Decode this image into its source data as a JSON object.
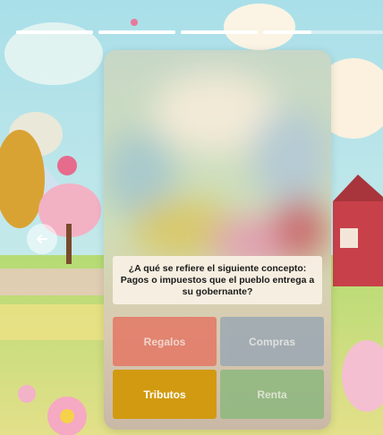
{
  "progress": {
    "total_segments": 4,
    "filled_fraction": [
      1,
      1,
      1,
      0.4
    ]
  },
  "question": {
    "text": "¿A qué se refiere el siguiente concepto: Pagos o impuestos que el pueblo entrega a su gobernante?"
  },
  "options": [
    {
      "label": "Regalos",
      "color": "#e47562",
      "selected": false
    },
    {
      "label": "Compras",
      "color": "#98a7b3",
      "selected": false
    },
    {
      "label": "Tributos",
      "color": "#d29a10",
      "selected": true
    },
    {
      "label": "Renta",
      "color": "#8ab87c",
      "selected": false
    }
  ],
  "colors": {
    "sky": "#bfe6ee",
    "meadow": "#9ed06b",
    "card_overlay": "#d8c9b6",
    "question_bg": "#f8f0e4"
  },
  "icons": {
    "back": "arrow-left-icon"
  }
}
